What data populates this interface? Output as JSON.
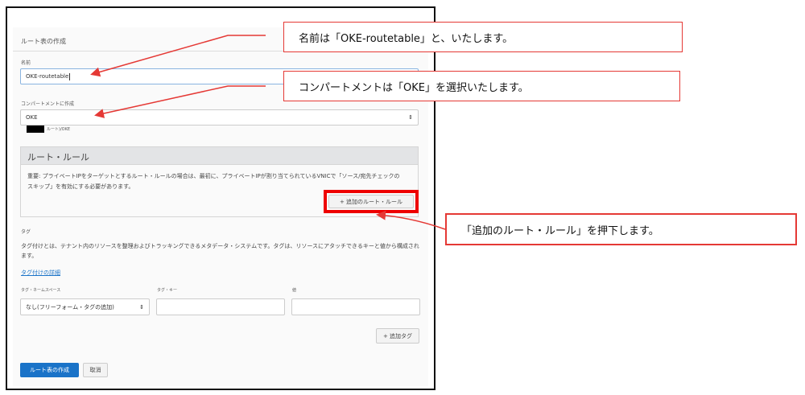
{
  "form": {
    "title": "ルート表の作成",
    "name_label": "名前",
    "name_value": "OKE-routetable",
    "compartment_label": "コンパートメントに作成",
    "compartment_value": "OKE",
    "compartment_path": "ルート)/OKE",
    "rules_section": {
      "title": "ルート・ルール",
      "note": "重要: プライベートIPをターゲットとするルート・ルールの場合は、最初に、プライベートIPが割り当てられているVNICで「ソース/宛先チェックのスキップ」を有効にする必要があります。",
      "add_rule_button": "+ 追加のルート・ルール"
    },
    "tags": {
      "title": "タグ",
      "description": "タグ付けとは、テナント内のリソースを整理およびトラッキングできるメタデータ・システムです。タグは、リソースにアタッチできるキーと値から構成されます。",
      "learn_more_link": "タグ付けの詳細",
      "namespace_label": "タグ・ネームスペース",
      "namespace_value": "なし(フリーフォーム・タグの追加)",
      "key_label": "タグ・キー",
      "value_label": "値",
      "add_tag_button": "+ 追加タグ"
    },
    "create_button": "ルート表の作成",
    "cancel_button": "取消"
  },
  "callouts": [
    "名前は「OKE-routetable」と、いたします。",
    "コンパートメントは「OKE」を選択いたします。",
    "「追加のルート・ルール」を押下します。"
  ],
  "colors": {
    "accent": "#1a73c8",
    "annotation": "#e53935"
  }
}
